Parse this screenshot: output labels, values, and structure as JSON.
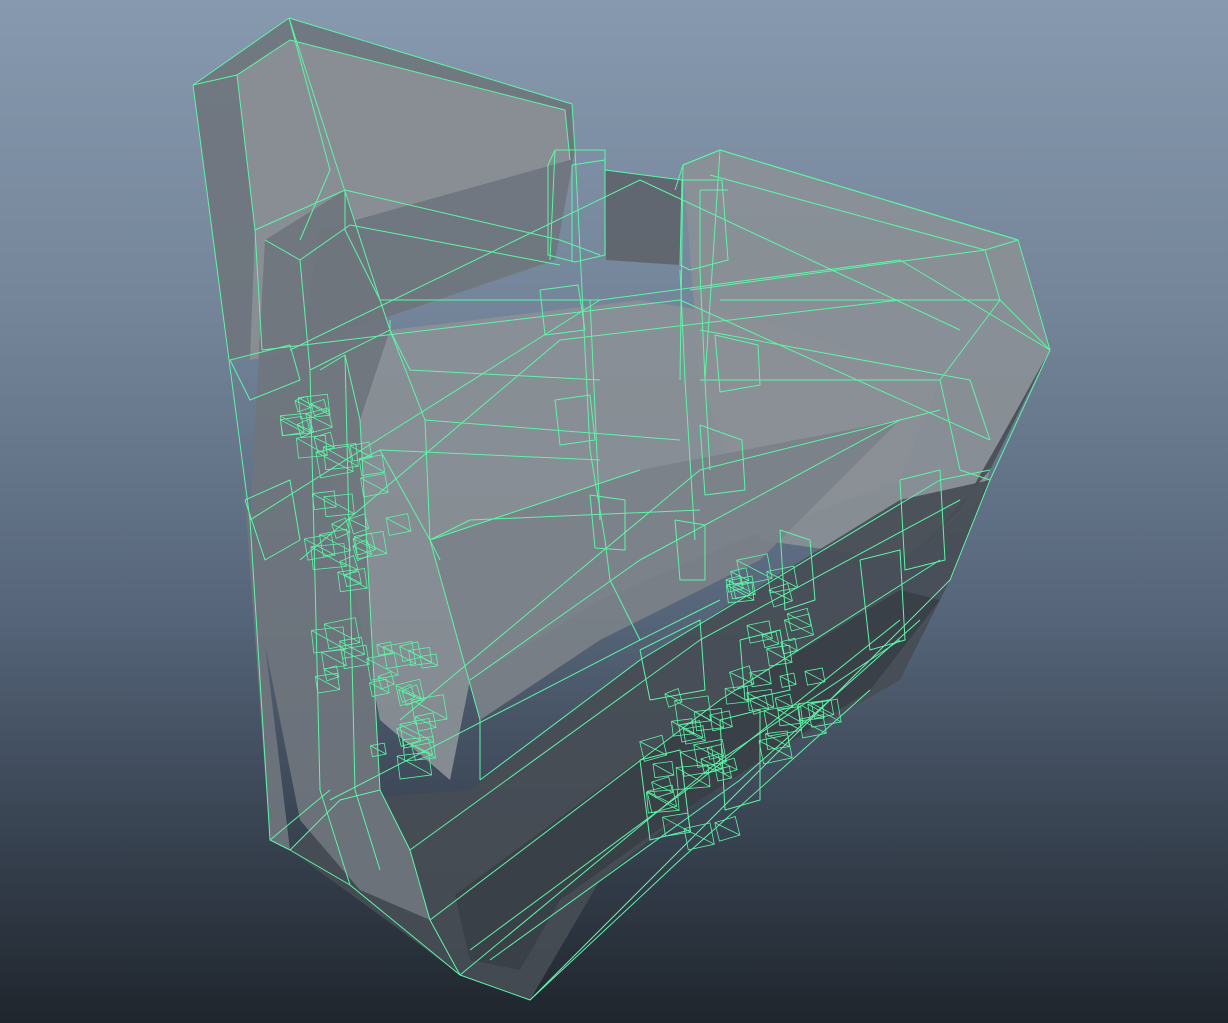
{
  "viewport": {
    "background_top": "#8799ae",
    "background_bottom": "#1f252c"
  },
  "mesh": {
    "wireframe_color": "#5df5a6",
    "shade_light": "#8a9096",
    "shade_mid": "#6f757d",
    "shade_dark": "#474d55",
    "display_mode": "wireframe-on-shaded"
  }
}
